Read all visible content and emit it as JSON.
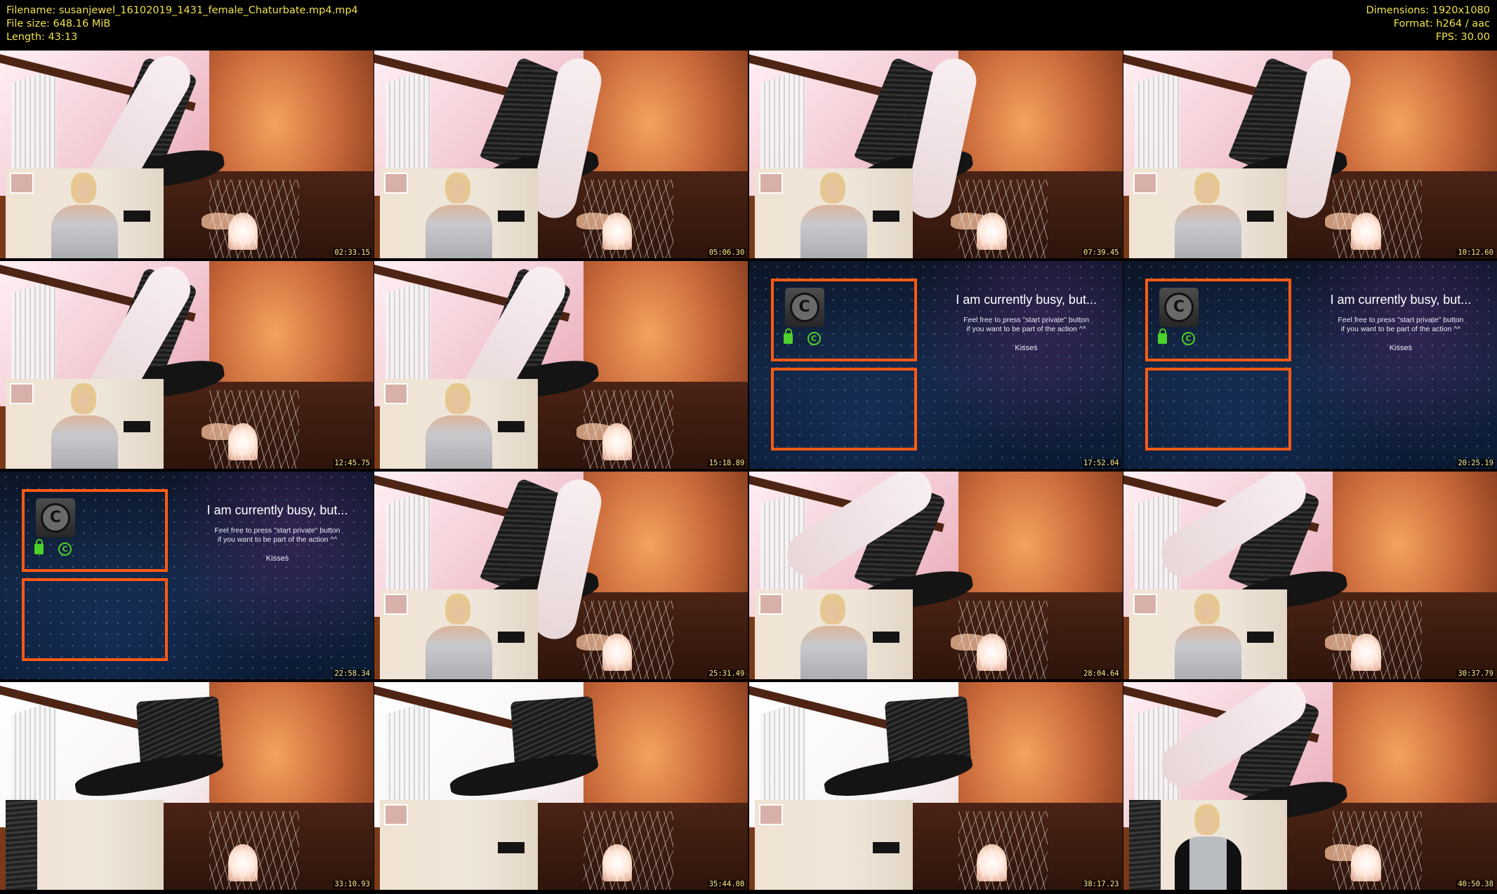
{
  "header": {
    "filename": "Filename: susanjewel_16102019_1431_female_Chaturbate.mp4.mp4",
    "filesize": "File size: 648.16 MiB",
    "length": "Length: 43:13",
    "dimensions": "Dimensions: 1920x1080",
    "format": "Format: h264 / aac",
    "fps": "FPS: 30.00"
  },
  "busy_screen": {
    "title": "I am currently busy, but...",
    "line1": "Feel free to press \"start private\" button",
    "line2": "if you want to be part of the action ^^",
    "kisses": "Kisses",
    "logo_symbol": "C",
    "copyright_symbol": "C"
  },
  "frames": [
    {
      "timestamp": "02:33.15",
      "kind": "cam"
    },
    {
      "timestamp": "05:06.30",
      "kind": "cam"
    },
    {
      "timestamp": "07:39.45",
      "kind": "cam"
    },
    {
      "timestamp": "10:12.60",
      "kind": "cam"
    },
    {
      "timestamp": "12:45.75",
      "kind": "cam"
    },
    {
      "timestamp": "15:18.89",
      "kind": "cam"
    },
    {
      "timestamp": "17:52.04",
      "kind": "busy"
    },
    {
      "timestamp": "20:25.19",
      "kind": "busy"
    },
    {
      "timestamp": "22:58.34",
      "kind": "busy"
    },
    {
      "timestamp": "25:31.49",
      "kind": "cam"
    },
    {
      "timestamp": "28:04.64",
      "kind": "cam"
    },
    {
      "timestamp": "30:37.79",
      "kind": "cam"
    },
    {
      "timestamp": "33:10.93",
      "kind": "cam"
    },
    {
      "timestamp": "35:44.08",
      "kind": "cam"
    },
    {
      "timestamp": "38:17.23",
      "kind": "cam"
    },
    {
      "timestamp": "40:50.38",
      "kind": "cam"
    }
  ]
}
